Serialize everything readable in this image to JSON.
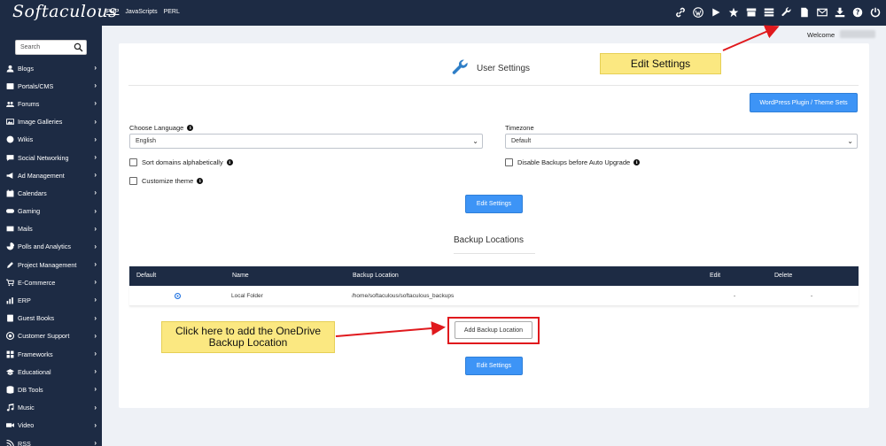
{
  "topbar": {
    "logo": "Softaculous",
    "langs": [
      "PHP",
      "JavaScripts",
      "PERL"
    ],
    "icons": [
      "link-icon",
      "wordpress-icon",
      "play-icon",
      "star-icon",
      "archive-icon",
      "list-icon",
      "wrench-icon",
      "file-icon",
      "mail-icon",
      "download-icon",
      "help-icon",
      "logout-icon"
    ]
  },
  "sidebar": {
    "search_placeholder": "Search",
    "items": [
      {
        "label": "Blogs",
        "icon": "user-icon"
      },
      {
        "label": "Portals/CMS",
        "icon": "portal-icon"
      },
      {
        "label": "Forums",
        "icon": "users-icon"
      },
      {
        "label": "Image Galleries",
        "icon": "image-icon"
      },
      {
        "label": "Wikis",
        "icon": "globe-icon"
      },
      {
        "label": "Social Networking",
        "icon": "chat-icon"
      },
      {
        "label": "Ad Management",
        "icon": "megaphone-icon"
      },
      {
        "label": "Calendars",
        "icon": "calendar-icon"
      },
      {
        "label": "Gaming",
        "icon": "gamepad-icon"
      },
      {
        "label": "Mails",
        "icon": "mail-icon"
      },
      {
        "label": "Polls and Analytics",
        "icon": "pie-icon"
      },
      {
        "label": "Project Management",
        "icon": "edit-icon"
      },
      {
        "label": "E-Commerce",
        "icon": "cart-icon"
      },
      {
        "label": "ERP",
        "icon": "chart-icon"
      },
      {
        "label": "Guest Books",
        "icon": "guestbook-icon"
      },
      {
        "label": "Customer Support",
        "icon": "support-icon"
      },
      {
        "label": "Frameworks",
        "icon": "frameworks-icon"
      },
      {
        "label": "Educational",
        "icon": "graduation-icon"
      },
      {
        "label": "DB Tools",
        "icon": "database-icon"
      },
      {
        "label": "Music",
        "icon": "music-icon"
      },
      {
        "label": "Video",
        "icon": "video-icon"
      },
      {
        "label": "RSS",
        "icon": "rss-icon"
      }
    ]
  },
  "welcome": "Welcome",
  "main": {
    "title": "User Settings",
    "wp_button": "WordPress Plugin / Theme Sets",
    "language": {
      "label": "Choose Language",
      "value": "English"
    },
    "timezone": {
      "label": "Timezone",
      "value": "Default"
    },
    "checkboxes": {
      "sort_domains": "Sort domains alphabetically",
      "disable_backups": "Disable Backups before Auto Upgrade",
      "customize_theme": "Customize theme"
    },
    "edit_settings": "Edit Settings",
    "backup_title": "Backup Locations",
    "table": {
      "headers": [
        "Default",
        "Name",
        "Backup Location",
        "Edit",
        "Delete"
      ],
      "row": {
        "name": "Local Folder",
        "location": "/home/softaculous/softaculous_backups",
        "edit": "-",
        "delete": "-"
      }
    },
    "add_backup": "Add Backup Location"
  },
  "annotations": {
    "edit_settings_callout": "Edit Settings",
    "onedrive_callout": "Click here to add the OneDrive Backup Location",
    "arrow_color": "#e0191d",
    "callout_color": "#fbe881"
  }
}
